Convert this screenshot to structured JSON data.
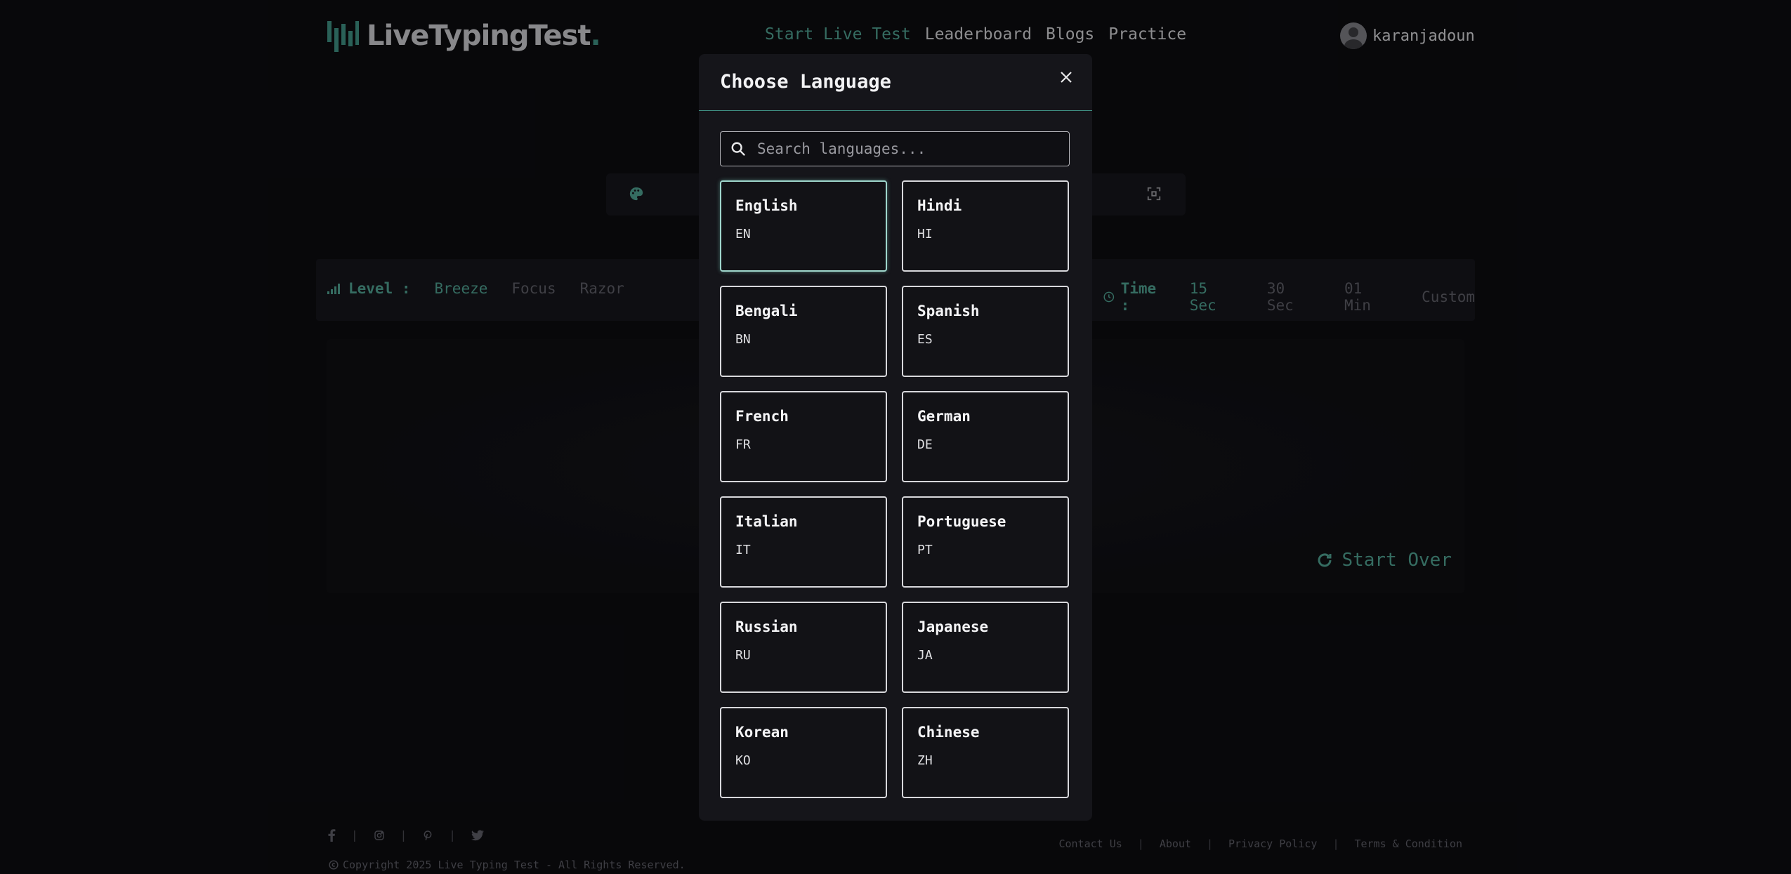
{
  "header": {
    "logo_text": "LiveTypingTest",
    "logo_dot": ".",
    "nav": [
      {
        "label": "Start Live Test",
        "active": true
      },
      {
        "label": "Leaderboard",
        "active": false
      },
      {
        "label": "Blogs",
        "active": false
      },
      {
        "label": "Practice",
        "active": false
      }
    ],
    "username": "karanjadoun"
  },
  "options": {
    "level_label": "Level :",
    "levels": [
      "Breeze",
      "Focus",
      "Razor"
    ],
    "active_level": "Breeze",
    "time_label": "Time :",
    "times": [
      "15 Sec",
      "30 Sec",
      "01 Min",
      "Custom"
    ],
    "active_time": "15 Sec"
  },
  "typing": {
    "start_over": "Start Over"
  },
  "modal": {
    "title": "Choose Language",
    "search_placeholder": "Search languages...",
    "selected": "English",
    "languages": [
      {
        "name": "English",
        "code": "EN"
      },
      {
        "name": "Hindi",
        "code": "HI"
      },
      {
        "name": "Bengali",
        "code": "BN"
      },
      {
        "name": "Spanish",
        "code": "ES"
      },
      {
        "name": "French",
        "code": "FR"
      },
      {
        "name": "German",
        "code": "DE"
      },
      {
        "name": "Italian",
        "code": "IT"
      },
      {
        "name": "Portuguese",
        "code": "PT"
      },
      {
        "name": "Russian",
        "code": "RU"
      },
      {
        "name": "Japanese",
        "code": "JA"
      },
      {
        "name": "Korean",
        "code": "KO"
      },
      {
        "name": "Chinese",
        "code": "ZH"
      }
    ]
  },
  "footer": {
    "social_icons": [
      "facebook-icon",
      "instagram-icon",
      "pinterest-icon",
      "twitter-icon"
    ],
    "copyright": "Copyright 2025 Live Typing Test - All Rights Reserved.",
    "links": [
      "Contact Us",
      "About",
      "Privacy Policy",
      "Terms & Condition"
    ]
  },
  "colors": {
    "accent": "#4f9f90",
    "background": "#0c0c10",
    "modal_background": "#15151a"
  }
}
